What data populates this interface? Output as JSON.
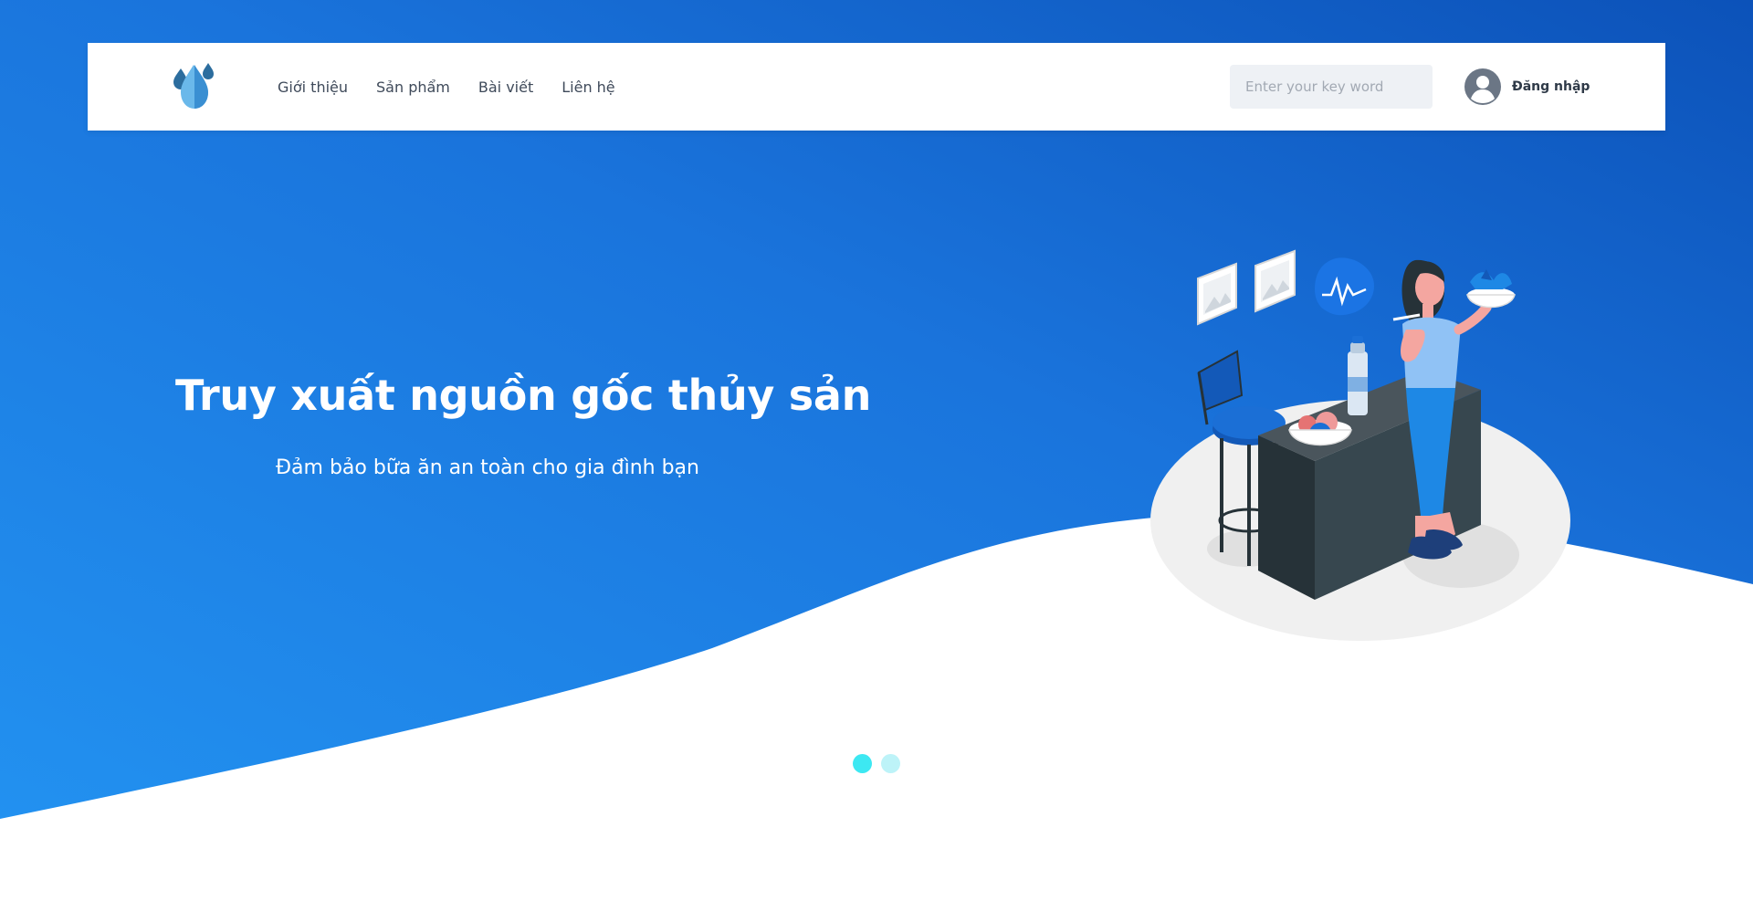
{
  "colors": {
    "brand_blue": "#1c7fe6",
    "brand_blue_dark": "#0f5ac1",
    "dot_active": "#3de8f2",
    "dot_inactive": "#bdf3f8",
    "text_dark": "#3f4a5a"
  },
  "header": {
    "logo_icon": "water-drops-icon",
    "nav": [
      {
        "label": "Giới thiệu"
      },
      {
        "label": "Sản phẩm"
      },
      {
        "label": "Bài viết"
      },
      {
        "label": "Liên hệ"
      }
    ],
    "search": {
      "placeholder": "Enter your key word",
      "value": ""
    },
    "login": {
      "label": "Đăng nhập",
      "icon": "user-avatar-icon"
    }
  },
  "hero": {
    "title": "Truy xuất nguồn gốc thủy sản",
    "subtitle": "Đảm bảo bữa ăn an toàn cho gia đình bạn",
    "illustration": "woman-eating-salad-illustration"
  },
  "carousel": {
    "slide_count": 2,
    "active_index": 0
  }
}
